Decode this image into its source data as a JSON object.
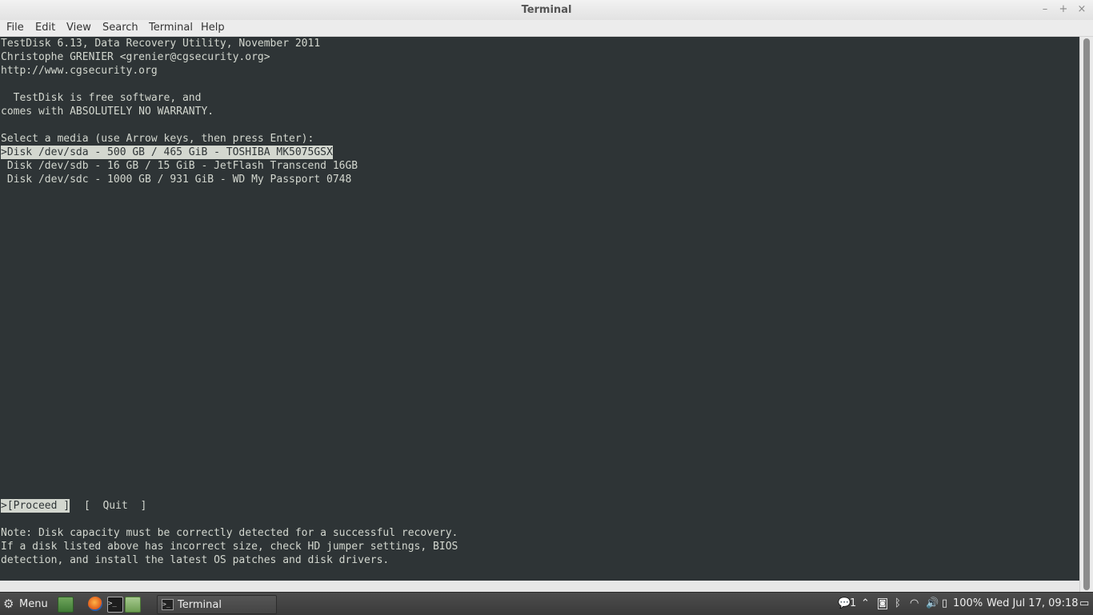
{
  "window": {
    "title": "Terminal",
    "controls": {
      "minimize": "–",
      "maximize": "+",
      "close": "×"
    }
  },
  "menubar": {
    "items": [
      "File",
      "Edit",
      "View",
      "Search",
      "Terminal",
      "Help"
    ]
  },
  "terminal": {
    "header": [
      "TestDisk 6.13, Data Recovery Utility, November 2011",
      "Christophe GRENIER <grenier@cgsecurity.org>",
      "http://www.cgsecurity.org"
    ],
    "license": [
      "  TestDisk is free software, and",
      "comes with ABSOLUTELY NO WARRANTY."
    ],
    "prompt": "Select a media (use Arrow keys, then press Enter):",
    "disks": [
      ">Disk /dev/sda - 500 GB / 465 GiB - TOSHIBA MK5075GSX",
      " Disk /dev/sdb - 16 GB / 15 GiB - JetFlash Transcend 16GB",
      " Disk /dev/sdc - 1000 GB / 931 GiB - WD My Passport 0748"
    ],
    "actions": {
      "proceed": ">[Proceed ]",
      "quit": "[  Quit  ]"
    },
    "note": [
      "Note: Disk capacity must be correctly detected for a successful recovery.",
      "If a disk listed above has incorrect size, check HD jumper settings, BIOS",
      "detection, and install the latest OS patches and disk drivers."
    ]
  },
  "panel": {
    "menu_label": "Menu",
    "task_label": "Terminal",
    "notifications": "1",
    "battery": "100%",
    "clock": "Wed Jul 17, 09:18",
    "icons": [
      "gear-icon",
      "show-desktop-icon",
      "firefox-icon",
      "terminal-icon",
      "files-icon",
      "notification-icon",
      "chevron-up-icon",
      "network-manager-icon",
      "bluetooth-icon",
      "wifi-icon",
      "volume-icon",
      "battery-icon",
      "workspace-icon"
    ]
  }
}
